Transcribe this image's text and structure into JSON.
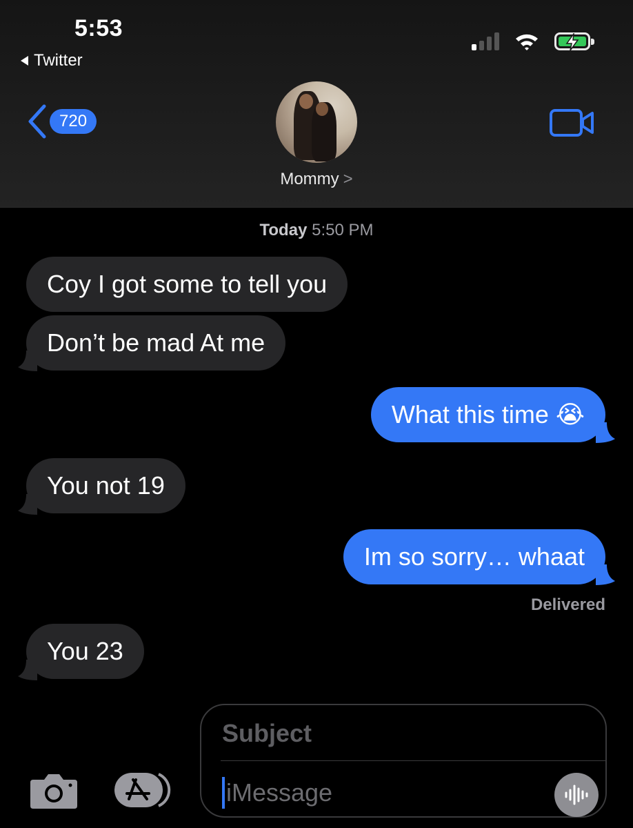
{
  "status_bar": {
    "time": "5:53",
    "back_app": "Twitter",
    "battery_color": "#34c759"
  },
  "nav": {
    "unread_count": "720",
    "contact_name": "Mommy",
    "contact_chevron": ">",
    "accent": "#3478f6",
    "video_icon": "video-camera-icon"
  },
  "conversation": {
    "timestamp_day": "Today",
    "timestamp_time": "5:50 PM",
    "messages": [
      {
        "from": "them",
        "text": "Coy I got some to tell you"
      },
      {
        "from": "them",
        "text": "Don’t be mad At me"
      },
      {
        "from": "me",
        "text": "What this time 😭"
      },
      {
        "from": "them",
        "text": "You not 19"
      },
      {
        "from": "me",
        "text": "Im so sorry… whaat"
      },
      {
        "from": "them",
        "text": "You 23"
      }
    ],
    "delivered_label": "Delivered"
  },
  "composer": {
    "subject_placeholder": "Subject",
    "message_placeholder": "iMessage",
    "camera_icon": "camera-icon",
    "appstore_icon": "app-store-icon",
    "audio_icon": "audio-waveform-icon"
  }
}
